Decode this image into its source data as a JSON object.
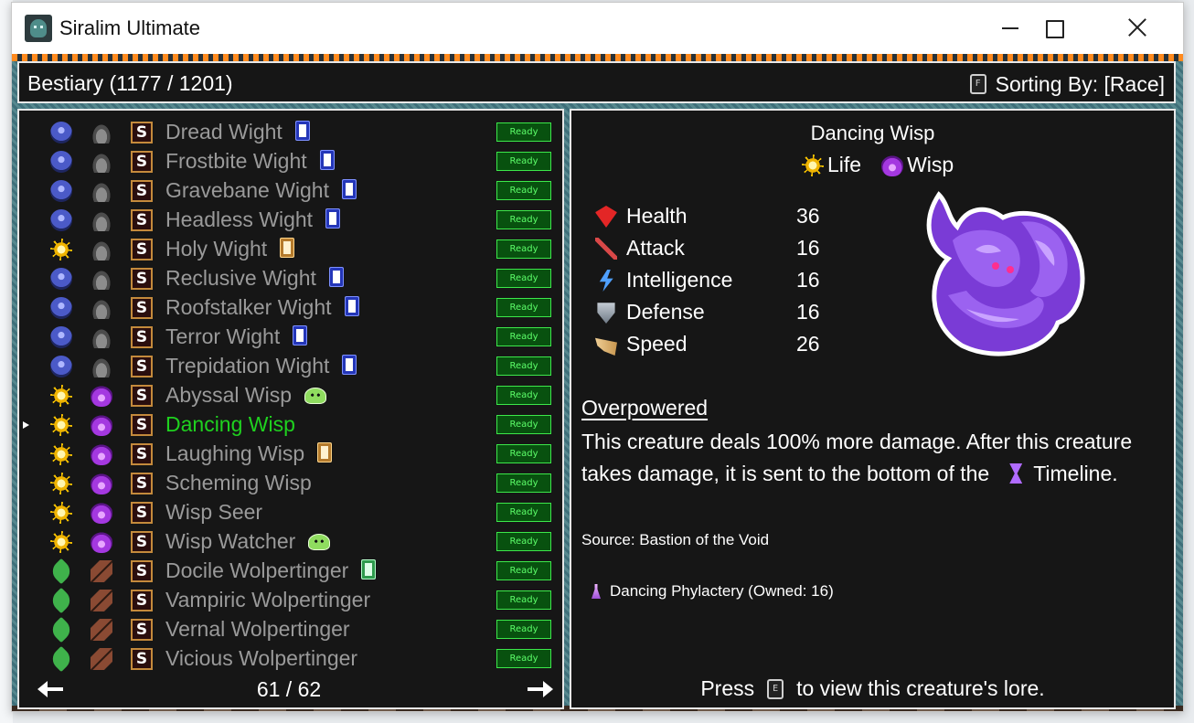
{
  "window": {
    "title": "Siralim Ultimate"
  },
  "header": {
    "title": "Bestiary (1177 / 1201)",
    "sort_key": "F",
    "sort_label": "Sorting By: [Race]"
  },
  "list": {
    "rows": [
      {
        "race_icon": "spirit-icon",
        "class_icon": "wight-icon",
        "name": "Dread Wight",
        "card": "blue",
        "status": "Ready"
      },
      {
        "race_icon": "spirit-icon",
        "class_icon": "wight-icon",
        "name": "Frostbite Wight",
        "card": "blue",
        "status": "Ready"
      },
      {
        "race_icon": "spirit-icon",
        "class_icon": "wight-icon",
        "name": "Gravebane Wight",
        "card": "blue",
        "status": "Ready"
      },
      {
        "race_icon": "spirit-icon",
        "class_icon": "wight-icon",
        "name": "Headless Wight",
        "card": "blue",
        "status": "Ready"
      },
      {
        "race_icon": "life-icon",
        "class_icon": "wight-icon",
        "name": "Holy Wight",
        "card": "gold",
        "status": "Ready"
      },
      {
        "race_icon": "spirit-icon",
        "class_icon": "wight-icon",
        "name": "Reclusive Wight",
        "card": "blue",
        "status": "Ready"
      },
      {
        "race_icon": "spirit-icon",
        "class_icon": "wight-icon",
        "name": "Roofstalker Wight",
        "card": "blue",
        "status": "Ready"
      },
      {
        "race_icon": "spirit-icon",
        "class_icon": "wight-icon",
        "name": "Terror Wight",
        "card": "blue",
        "status": "Ready"
      },
      {
        "race_icon": "spirit-icon",
        "class_icon": "wight-icon",
        "name": "Trepidation Wight",
        "card": "blue",
        "status": "Ready"
      },
      {
        "race_icon": "life-icon",
        "class_icon": "wisp-icon",
        "name": "Abyssal Wisp",
        "card": "slime",
        "status": "Ready"
      },
      {
        "race_icon": "life-icon",
        "class_icon": "wisp-icon",
        "name": "Dancing Wisp",
        "card": "",
        "status": "Ready",
        "selected": true
      },
      {
        "race_icon": "life-icon",
        "class_icon": "wisp-icon",
        "name": "Laughing Wisp",
        "card": "gold",
        "status": "Ready"
      },
      {
        "race_icon": "life-icon",
        "class_icon": "wisp-icon",
        "name": "Scheming Wisp",
        "card": "",
        "status": "Ready"
      },
      {
        "race_icon": "life-icon",
        "class_icon": "wisp-icon",
        "name": "Wisp Seer",
        "card": "",
        "status": "Ready"
      },
      {
        "race_icon": "life-icon",
        "class_icon": "wisp-icon",
        "name": "Wisp Watcher",
        "card": "slime",
        "status": "Ready"
      },
      {
        "race_icon": "nature-icon",
        "class_icon": "wolpertinger-icon",
        "name": "Docile Wolpertinger",
        "card": "green",
        "status": "Ready"
      },
      {
        "race_icon": "nature-icon",
        "class_icon": "wolpertinger-icon",
        "name": "Vampiric Wolpertinger",
        "card": "",
        "status": "Ready"
      },
      {
        "race_icon": "nature-icon",
        "class_icon": "wolpertinger-icon",
        "name": "Vernal Wolpertinger",
        "card": "",
        "status": "Ready"
      },
      {
        "race_icon": "nature-icon",
        "class_icon": "wolpertinger-icon",
        "name": "Vicious Wolpertinger",
        "card": "",
        "status": "Ready"
      }
    ],
    "page": "61 / 62"
  },
  "detail": {
    "name": "Dancing Wisp",
    "race": "Life",
    "klass": "Wisp",
    "stats": [
      {
        "label": "Health",
        "value": "36",
        "icon": "heart-icon"
      },
      {
        "label": "Attack",
        "value": "16",
        "icon": "sword-icon"
      },
      {
        "label": "Intelligence",
        "value": "16",
        "icon": "lightning-icon"
      },
      {
        "label": "Defense",
        "value": "16",
        "icon": "shield-icon"
      },
      {
        "label": "Speed",
        "value": "26",
        "icon": "wing-icon"
      }
    ],
    "trait_name": "Overpowered",
    "trait_desc_a": "This creature deals 100% more damage. After this creature takes damage, it is sent to the bottom of the",
    "trait_desc_b": "Timeline.",
    "source": "Source: Bastion of the Void",
    "material": "Dancing Phylactery (Owned: 16)",
    "lore_press": "Press",
    "lore_key": "E",
    "lore_rest": "to view this creature's lore."
  },
  "colors": {
    "selected": "#1fd21f",
    "normal": "#9a9a9a",
    "ready_bg": "#08510f",
    "ready_text": "#5dff6a",
    "panel_bg": "#161616"
  }
}
